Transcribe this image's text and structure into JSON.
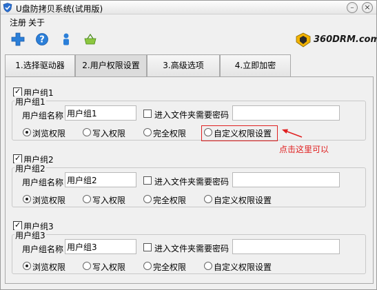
{
  "window": {
    "title": "U盘防拷贝系统(试用版)"
  },
  "menu": {
    "items": [
      "注册",
      "关于"
    ]
  },
  "logo": {
    "text": "360DRM.com"
  },
  "tabs": [
    {
      "label": "1.选择驱动器",
      "active": false
    },
    {
      "label": "2.用户权限设置",
      "active": true
    },
    {
      "label": "3.高级选项",
      "active": false
    },
    {
      "label": "4.立即加密",
      "active": false
    }
  ],
  "groups": [
    {
      "checkbox_label": "用户组1",
      "box_label": "用户组1",
      "name_label": "用户组名称",
      "name_value": "用户组1",
      "password_label": "进入文件夹需要密码",
      "password_value": "",
      "radios": [
        "浏览权限",
        "写入权限",
        "完全权限",
        "自定义权限设置"
      ],
      "selected_radio": 0
    },
    {
      "checkbox_label": "用户组2",
      "box_label": "用户组2",
      "name_label": "用户组名称",
      "name_value": "用户组2",
      "password_label": "进入文件夹需要密码",
      "password_value": "",
      "radios": [
        "浏览权限",
        "写入权限",
        "完全权限",
        "自定义权限设置"
      ],
      "selected_radio": 0
    },
    {
      "checkbox_label": "用户组3",
      "box_label": "用户组3",
      "name_label": "用户组名称",
      "name_value": "用户组3",
      "password_label": "进入文件夹需要密码",
      "password_value": "",
      "radios": [
        "浏览权限",
        "写入权限",
        "完全权限",
        "自定义权限设置"
      ],
      "selected_radio": 0
    }
  ],
  "annotation": {
    "text": "点击这里可以",
    "color": "#e02020"
  },
  "toolbar": {
    "icons": [
      "add-icon",
      "help-icon",
      "user-icon",
      "basket-icon"
    ]
  }
}
